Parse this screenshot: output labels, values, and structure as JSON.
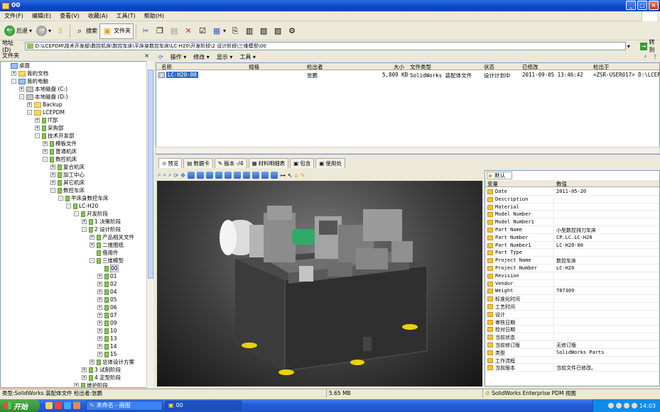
{
  "window": {
    "title": "00"
  },
  "menu": [
    "文件(F)",
    "编辑(E)",
    "查看(V)",
    "收藏(A)",
    "工具(T)",
    "帮助(H)"
  ],
  "toolbar": {
    "back": "后退",
    "search": "搜索",
    "folders": "文件夹"
  },
  "address": {
    "label": "地址(D)",
    "path": "D:\\LCEPDM\\技术开发部\\数控机床\\数控车床\\平床身数控车床\\LC-H20\\开发阶段\\2 设计阶段\\三维模型\\00",
    "go": "转到"
  },
  "folder_pane": {
    "title": "文件夹",
    "close": "×"
  },
  "tree": [
    {
      "label": "桌面",
      "level": 0,
      "exp": "",
      "icon": "desktop"
    },
    {
      "label": "我的文档",
      "level": 1,
      "exp": "+",
      "icon": "folder"
    },
    {
      "label": "我的电脑",
      "level": 1,
      "exp": "-",
      "icon": "pc"
    },
    {
      "label": "本地磁盘 (C:)",
      "level": 2,
      "exp": "+",
      "icon": "drive"
    },
    {
      "label": "本地磁盘 (D:)",
      "level": 2,
      "exp": "-",
      "icon": "drive"
    },
    {
      "label": "Backup",
      "level": 3,
      "exp": "+",
      "icon": "folder"
    },
    {
      "label": "LCEPDM",
      "level": 3,
      "exp": "-",
      "icon": "folder"
    },
    {
      "label": "IT部",
      "level": 4,
      "exp": "+",
      "icon": "green"
    },
    {
      "label": "采购部",
      "level": 4,
      "exp": "+",
      "icon": "green"
    },
    {
      "label": "技术开发部",
      "level": 4,
      "exp": "-",
      "icon": "green"
    },
    {
      "label": "模板文件",
      "level": 5,
      "exp": "+",
      "icon": "green"
    },
    {
      "label": "普通机床",
      "level": 5,
      "exp": "+",
      "icon": "green"
    },
    {
      "label": "数控机床",
      "level": 5,
      "exp": "-",
      "icon": "green"
    },
    {
      "label": "复合机床",
      "level": 6,
      "exp": "+",
      "icon": "green"
    },
    {
      "label": "加工中心",
      "level": 6,
      "exp": "+",
      "icon": "green"
    },
    {
      "label": "其它机床",
      "level": 6,
      "exp": "+",
      "icon": "green"
    },
    {
      "label": "数控车床",
      "level": 6,
      "exp": "-",
      "icon": "green"
    },
    {
      "label": "平床身数控车床",
      "level": 7,
      "exp": "-",
      "icon": "green"
    },
    {
      "label": "LC-H20",
      "level": 8,
      "exp": "-",
      "icon": "green"
    },
    {
      "label": "开发阶段",
      "level": 9,
      "exp": "-",
      "icon": "green"
    },
    {
      "label": "1 决策阶段",
      "level": 10,
      "exp": "+",
      "icon": "green"
    },
    {
      "label": "2 设计阶段",
      "level": 10,
      "exp": "-",
      "icon": "green"
    },
    {
      "label": "产品相关文件",
      "level": 11,
      "exp": "+",
      "icon": "green"
    },
    {
      "label": "二维图纸",
      "level": 11,
      "exp": "+",
      "icon": "green"
    },
    {
      "label": "借用件",
      "level": 11,
      "exp": "",
      "icon": "green"
    },
    {
      "label": "三维模型",
      "level": 11,
      "exp": "-",
      "icon": "green"
    },
    {
      "label": "00",
      "level": 12,
      "exp": "",
      "icon": "green",
      "selected": true
    },
    {
      "label": "01",
      "level": 12,
      "exp": "+",
      "icon": "green"
    },
    {
      "label": "02",
      "level": 12,
      "exp": "+",
      "icon": "green"
    },
    {
      "label": "04",
      "level": 12,
      "exp": "+",
      "icon": "green"
    },
    {
      "label": "05",
      "level": 12,
      "exp": "+",
      "icon": "green"
    },
    {
      "label": "06",
      "level": 12,
      "exp": "+",
      "icon": "green"
    },
    {
      "label": "07",
      "level": 12,
      "exp": "+",
      "icon": "green"
    },
    {
      "label": "09",
      "level": 12,
      "exp": "+",
      "icon": "green"
    },
    {
      "label": "10",
      "level": 12,
      "exp": "+",
      "icon": "green"
    },
    {
      "label": "13",
      "level": 12,
      "exp": "+",
      "icon": "green"
    },
    {
      "label": "14",
      "level": 12,
      "exp": "+",
      "icon": "green"
    },
    {
      "label": "15",
      "level": 12,
      "exp": "+",
      "icon": "green"
    },
    {
      "label": "总体设计方案",
      "level": 11,
      "exp": "+",
      "icon": "green"
    },
    {
      "label": "3 试制阶段",
      "level": 10,
      "exp": "+",
      "icon": "green"
    },
    {
      "label": "4 定型阶段",
      "level": 10,
      "exp": "+",
      "icon": "green"
    },
    {
      "label": "维护阶段",
      "level": 9,
      "exp": "+",
      "icon": "green"
    }
  ],
  "commands": [
    "操作 ▾",
    "修改 ▾",
    "显示 ▾",
    "工具 ▾"
  ],
  "columns": [
    "名称",
    "规格",
    "检出者",
    "大小",
    "文件类型",
    "状态",
    "已修改",
    "检出于"
  ],
  "file": {
    "name": "LC-H20-00",
    "spec": "",
    "checked_out_by": "张鹏",
    "size": "5,809 KB",
    "type": "SolidWorks 装配体文件",
    "state": "设计计划中",
    "modified": "2011-09-05 13:46:42",
    "checked_out_at": "<ZSR-USER017> D:\\LCEPDM"
  },
  "tabs": [
    "预览",
    "数据卡",
    "版本 -/4",
    "材料明细表",
    "包含",
    "使用处"
  ],
  "props": {
    "tab": "默认",
    "headers": [
      "变量",
      "数值"
    ],
    "rows": [
      {
        "name": "Date",
        "value": "2011-05-20"
      },
      {
        "name": "Description",
        "value": ""
      },
      {
        "name": "Material",
        "value": ""
      },
      {
        "name": "Model Number",
        "value": ""
      },
      {
        "name": "Model Number1",
        "value": ""
      },
      {
        "name": "Part Name",
        "value": "小型数控排刀车床"
      },
      {
        "name": "Part Number",
        "value": "CP.LC.LC-H20"
      },
      {
        "name": "Part Number1",
        "value": "LC-H20-00"
      },
      {
        "name": "Part Type",
        "value": ""
      },
      {
        "name": "Project Name",
        "value": "数控车床"
      },
      {
        "name": "Project Number",
        "value": "LC-H20"
      },
      {
        "name": "Revision",
        "value": ""
      },
      {
        "name": "Vendor",
        "value": ""
      },
      {
        "name": "Weight",
        "value": "787309"
      },
      {
        "name": "标准化时间",
        "value": ""
      },
      {
        "name": "工艺时间",
        "value": ""
      },
      {
        "name": "设计",
        "value": ""
      },
      {
        "name": "审核日期",
        "value": ""
      },
      {
        "name": "校对日期",
        "value": ""
      },
      {
        "name": "当前状态",
        "value": ""
      },
      {
        "name": "当前修订版",
        "value": "无修订版"
      },
      {
        "name": "类型",
        "value": "SolidWorks Parts"
      },
      {
        "name": "工作流程",
        "value": ""
      },
      {
        "name": "当前版本",
        "value": "当前文件已修改。"
      }
    ]
  },
  "status": {
    "type": "类型:SolidWorks 装配体文件  检出者:张鹏",
    "size": "5.65 MB",
    "view": "SolidWorks Enterprise PDM 视图"
  },
  "taskbar": {
    "start": "开始",
    "tasks": [
      "未命名 - 画图",
      "00"
    ],
    "clock": "14:03"
  }
}
